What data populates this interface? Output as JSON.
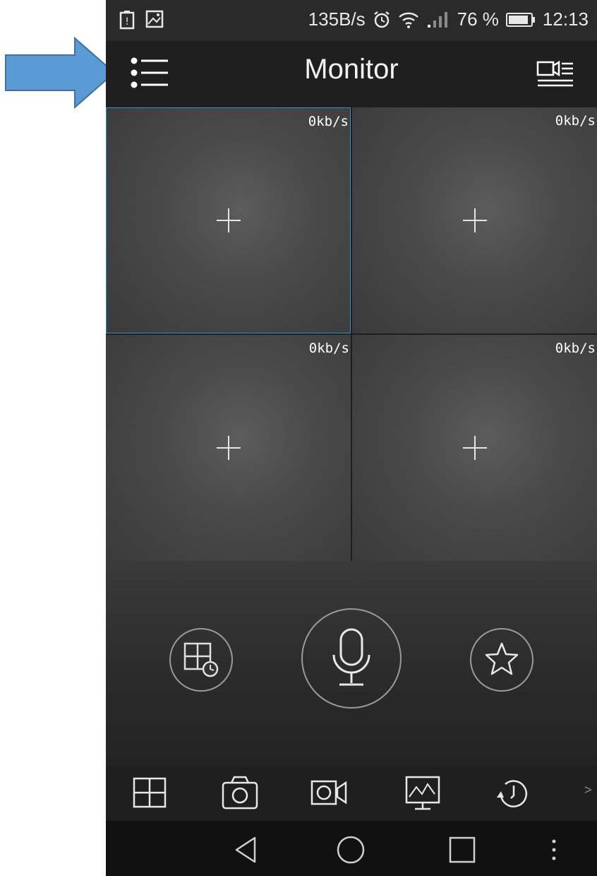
{
  "status_bar": {
    "left_icons": [
      "battery-warning-icon",
      "image-icon"
    ],
    "net_speed": "135B/s",
    "right_icons": [
      "alarm-icon",
      "wifi-icon",
      "signal-icon"
    ],
    "battery_percent": "76 %",
    "time": "12:13"
  },
  "app_bar": {
    "title": "Monitor",
    "menu_icon": "list-menu-icon",
    "device_list_icon": "camera-list-icon"
  },
  "video_grid": {
    "cells": [
      {
        "rate": "0kb/s",
        "selected": true
      },
      {
        "rate": "0kb/s",
        "selected": false
      },
      {
        "rate": "0kb/s",
        "selected": false
      },
      {
        "rate": "0kb/s",
        "selected": false
      }
    ]
  },
  "controls": [
    "layout-schedule-icon",
    "microphone-icon",
    "star-icon"
  ],
  "toolbar": {
    "items": [
      "grid-layout-icon",
      "camera-icon",
      "video-record-icon",
      "monitor-chart-icon",
      "playback-icon"
    ],
    "more": ">"
  },
  "nav_bar": [
    "back-icon",
    "home-icon",
    "recents-icon",
    "more-options-icon"
  ],
  "colors": {
    "selection": "#3b8fc4",
    "annotation_arrow": "#5b9bd5",
    "annotation_arrow_border": "#41719c"
  }
}
